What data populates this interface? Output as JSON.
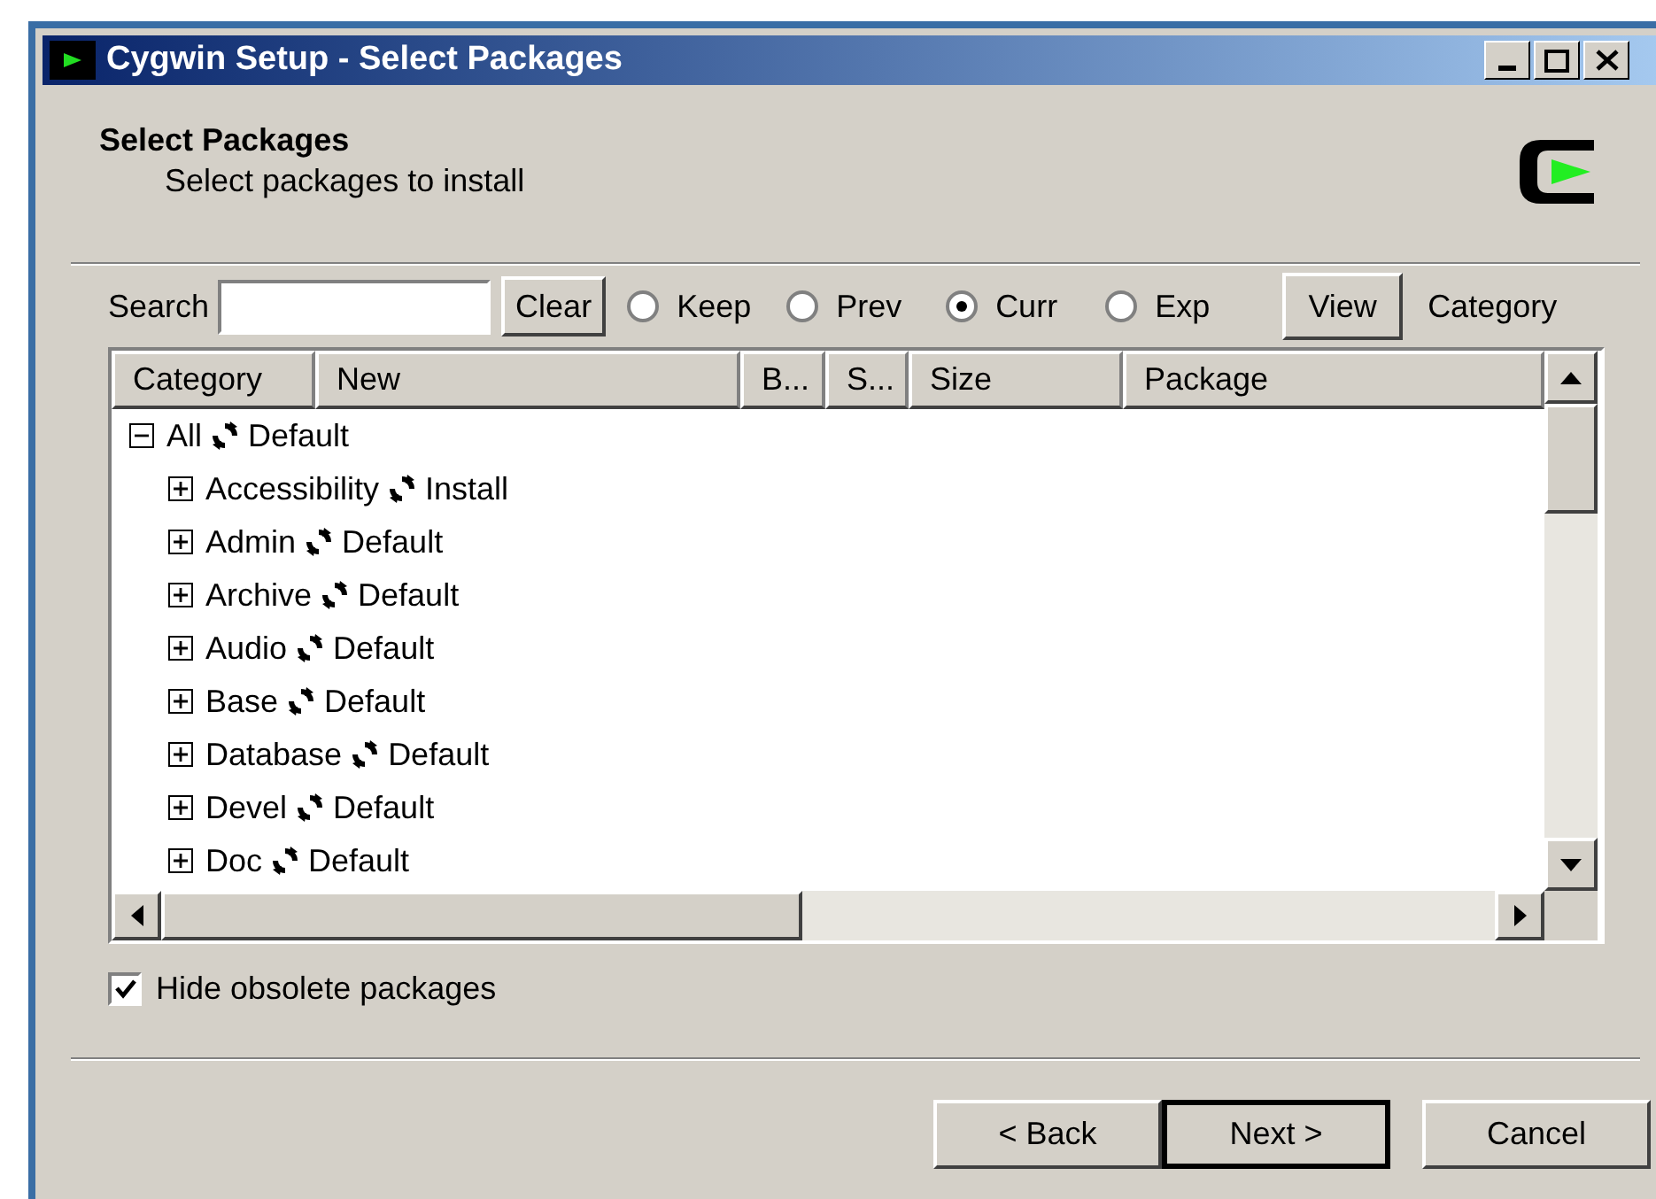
{
  "window": {
    "title": "Cygwin Setup - Select Packages"
  },
  "header": {
    "title": "Select Packages",
    "subtitle": "Select packages to install"
  },
  "search": {
    "label": "Search",
    "clear": "Clear"
  },
  "filters": [
    {
      "label": "Keep",
      "selected": false
    },
    {
      "label": "Prev",
      "selected": false
    },
    {
      "label": "Curr",
      "selected": true
    },
    {
      "label": "Exp",
      "selected": false
    }
  ],
  "view": {
    "button": "View",
    "mode": "Category"
  },
  "table": {
    "columns": [
      "Category",
      "New",
      "B...",
      "S...",
      "Size",
      "Package"
    ],
    "tree": [
      {
        "name": "All",
        "action": "Default",
        "expanded": true,
        "children": [
          {
            "name": "Accessibility",
            "action": "Install",
            "expanded": false
          },
          {
            "name": "Admin",
            "action": "Default",
            "expanded": false
          },
          {
            "name": "Archive",
            "action": "Default",
            "expanded": false
          },
          {
            "name": "Audio",
            "action": "Default",
            "expanded": false
          },
          {
            "name": "Base",
            "action": "Default",
            "expanded": false
          },
          {
            "name": "Database",
            "action": "Default",
            "expanded": false
          },
          {
            "name": "Devel",
            "action": "Default",
            "expanded": false
          },
          {
            "name": "Doc",
            "action": "Default",
            "expanded": false
          }
        ]
      }
    ]
  },
  "hide_obsolete": {
    "label": "Hide obsolete packages",
    "checked": true
  },
  "buttons": [
    "< Back",
    "Next >",
    "Cancel"
  ]
}
